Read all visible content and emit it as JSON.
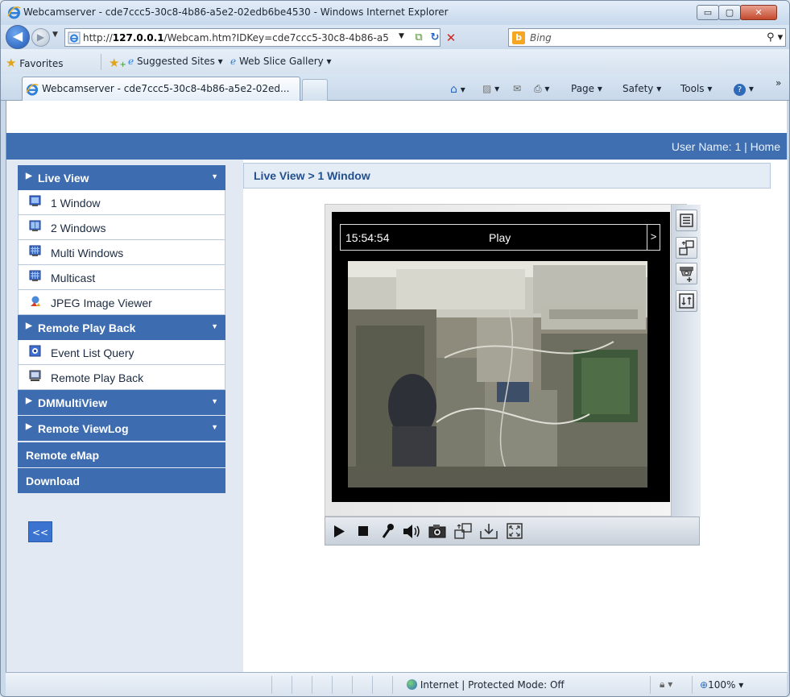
{
  "window": {
    "title": "Webcamserver - cde7ccc5-30c8-4b86-a5e2-02edb6be4530 - Windows Internet Explorer",
    "min_label": "▭",
    "max_label": "▢",
    "close_label": "✕"
  },
  "address": {
    "url_host": "127.0.0.1",
    "url_prefix": "http://",
    "url_rest": "/Webcam.htm?IDKey=cde7ccc5-30c8-4b86-a5",
    "search_placeholder": "Bing"
  },
  "favorites": {
    "favorites_label": "Favorites",
    "suggested_sites": "Suggested Sites ▾",
    "web_slice_gallery": "Web Slice Gallery ▾"
  },
  "tabs": {
    "active_title": "Webcamserver - cde7ccc5-30c8-4b86-a5e2-02ed...",
    "page_menu": "Page ▾",
    "safety_menu": "Safety ▾",
    "tools_menu": "Tools ▾",
    "chevron": "»"
  },
  "header": {
    "user_text": "User Name: 1 | Home"
  },
  "sidebar": {
    "live_view": "Live View",
    "live_items": [
      "1 Window",
      "2 Windows",
      "Multi Windows",
      "Multicast",
      "JPEG Image Viewer"
    ],
    "remote_play_back_head": "Remote Play Back",
    "playback_items": [
      "Event List Query",
      "Remote Play Back"
    ],
    "dmmultiview": "DMMultiView",
    "remote_viewlog": "Remote ViewLog",
    "remote_emap": "Remote eMap",
    "download": "Download",
    "collapse": "<<"
  },
  "main": {
    "breadcrumb": "Live View > 1 Window"
  },
  "player": {
    "time": "15:54:54",
    "status": "Play",
    "next": ">"
  },
  "statusbar": {
    "zone": "Internet | Protected Mode: Off",
    "zoom": "100%"
  },
  "colors": {
    "accent": "#3f6fb0",
    "menu_head": "#3d6db0"
  }
}
